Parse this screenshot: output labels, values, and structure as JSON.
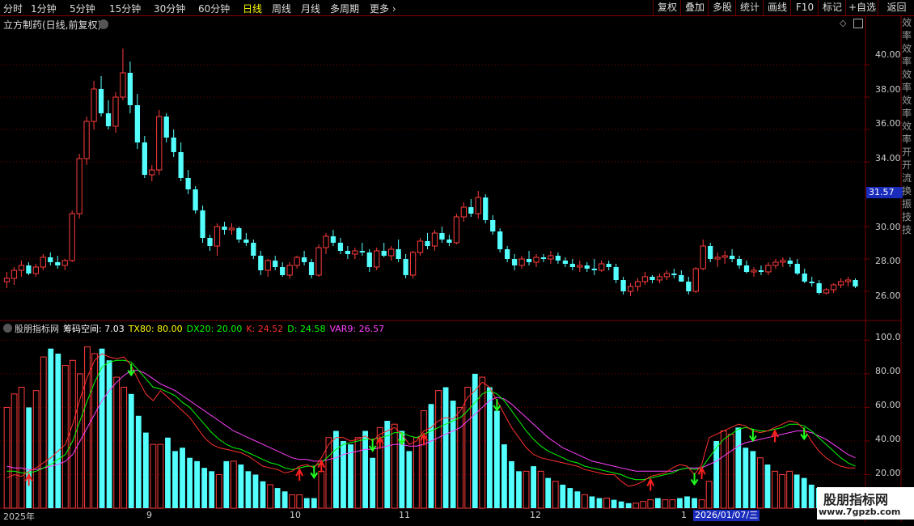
{
  "toolbar": {
    "periods": [
      "分时",
      "1分钟",
      "5分钟",
      "15分钟",
      "30分钟",
      "60分钟",
      "日线",
      "周线",
      "月线",
      "多周期",
      "更多 ›"
    ],
    "active_period": "日线",
    "right_buttons": [
      "复权",
      "叠加",
      "多股",
      "统计",
      "画线",
      "F10",
      "标记",
      "+自选",
      "返回"
    ]
  },
  "main_panel": {
    "title": "立方制药(日线,前复权)",
    "price_axis": [
      "40.00",
      "38.00",
      "36.00",
      "34.00",
      "31.57",
      "30.00",
      "28.00",
      "26.00"
    ],
    "current_price": "31.57",
    "sidebar_glyphs": [
      "效",
      "率",
      "效",
      "率",
      "效",
      "率",
      "效",
      "率",
      "效",
      "率",
      "开",
      "开",
      "流",
      "换",
      "振",
      "技",
      "技"
    ]
  },
  "indicator_panel": {
    "name": "股朋指标网",
    "items": [
      {
        "label": "筹码空间: 7.03",
        "color": "#ffffff"
      },
      {
        "label": "TX80: 80.00",
        "color": "#ffff00"
      },
      {
        "label": "DX20: 20.00",
        "color": "#00ff00"
      },
      {
        "label": "K: 24.52",
        "color": "#ff3030"
      },
      {
        "label": "D: 24.58",
        "color": "#00ff00"
      },
      {
        "label": "VAR9: 26.57",
        "color": "#ff40ff"
      }
    ],
    "axis": [
      "100.0",
      "80.00",
      "60.00",
      "40.00",
      "20.00"
    ]
  },
  "date_axis": {
    "ticks": [
      "2025年",
      "9",
      "10",
      "11",
      "12",
      "1"
    ],
    "cursor_date": "2026/01/07/三"
  },
  "watermark": {
    "line1": "股朋指标网",
    "line2": "www.7gpzb.com"
  },
  "colors": {
    "up": "#ff3c3c",
    "down": "#54ffff",
    "grid": "#7a0000",
    "k_line": "#ff3030",
    "d_line": "#00ff00",
    "var9_line": "#ff40ff"
  },
  "chart_data": [
    {
      "type": "candlestick",
      "title": "立方制药(日线,前复权)",
      "ylim": [
        25,
        42
      ],
      "ohlc": [
        [
          26.6,
          27.2,
          26.2,
          26.8
        ],
        [
          26.8,
          27.5,
          26.4,
          27.3
        ],
        [
          27.3,
          27.9,
          26.9,
          27.6
        ],
        [
          27.6,
          27.8,
          27.0,
          27.1
        ],
        [
          27.1,
          27.7,
          26.9,
          27.5
        ],
        [
          27.5,
          28.3,
          27.3,
          28.1
        ],
        [
          28.1,
          28.4,
          27.6,
          27.8
        ],
        [
          27.8,
          28.2,
          27.4,
          27.6
        ],
        [
          27.6,
          28.0,
          27.3,
          27.9
        ],
        [
          27.9,
          31.0,
          27.8,
          30.8
        ],
        [
          30.8,
          34.5,
          30.5,
          34.2
        ],
        [
          34.2,
          36.8,
          33.8,
          36.5
        ],
        [
          36.5,
          39.0,
          36.0,
          38.5
        ],
        [
          38.5,
          39.3,
          36.8,
          37.0
        ],
        [
          37.0,
          37.8,
          36.0,
          36.2
        ],
        [
          36.2,
          38.3,
          35.8,
          38.0
        ],
        [
          38.0,
          41.0,
          37.8,
          39.5
        ],
        [
          39.5,
          40.2,
          37.0,
          37.5
        ],
        [
          37.5,
          38.2,
          34.8,
          35.2
        ],
        [
          35.2,
          35.6,
          33.0,
          33.2
        ],
        [
          33.2,
          33.8,
          32.8,
          33.5
        ],
        [
          33.5,
          37.2,
          33.2,
          36.8
        ],
        [
          36.8,
          37.0,
          35.2,
          35.5
        ],
        [
          35.5,
          36.0,
          34.3,
          34.6
        ],
        [
          34.6,
          35.2,
          32.8,
          33.0
        ],
        [
          33.0,
          33.5,
          32.0,
          32.3
        ],
        [
          32.3,
          32.5,
          30.8,
          31.0
        ],
        [
          31.0,
          31.3,
          29.0,
          29.3
        ],
        [
          29.3,
          29.5,
          28.5,
          28.8
        ],
        [
          28.8,
          30.2,
          28.2,
          30.0
        ],
        [
          30.0,
          30.3,
          29.5,
          29.8
        ],
        [
          29.8,
          30.2,
          29.5,
          29.9
        ],
        [
          29.9,
          30.0,
          29.0,
          29.2
        ],
        [
          29.2,
          29.6,
          28.8,
          29.0
        ],
        [
          29.0,
          29.2,
          28.0,
          28.2
        ],
        [
          28.2,
          28.5,
          27.0,
          27.3
        ],
        [
          27.3,
          28.0,
          26.9,
          27.9
        ],
        [
          27.9,
          28.2,
          27.3,
          27.5
        ],
        [
          27.5,
          27.8,
          26.9,
          27.0
        ],
        [
          27.0,
          27.8,
          26.8,
          27.6
        ],
        [
          27.6,
          28.2,
          27.4,
          28.1
        ],
        [
          28.1,
          28.5,
          27.6,
          27.8
        ],
        [
          27.8,
          28.0,
          26.8,
          27.0
        ],
        [
          27.0,
          28.9,
          26.9,
          28.7
        ],
        [
          28.7,
          29.6,
          28.3,
          29.4
        ],
        [
          29.4,
          29.8,
          28.8,
          29.0
        ],
        [
          29.0,
          29.3,
          28.3,
          28.5
        ],
        [
          28.5,
          28.8,
          28.0,
          28.3
        ],
        [
          28.3,
          28.7,
          28.0,
          28.5
        ],
        [
          28.5,
          29.0,
          28.2,
          28.4
        ],
        [
          28.4,
          28.6,
          27.2,
          27.5
        ],
        [
          27.5,
          28.7,
          27.3,
          28.5
        ],
        [
          28.5,
          29.0,
          28.1,
          28.2
        ],
        [
          28.2,
          28.8,
          27.9,
          28.6
        ],
        [
          28.6,
          29.2,
          27.8,
          28.0
        ],
        [
          28.0,
          28.3,
          26.8,
          27.0
        ],
        [
          27.0,
          28.5,
          26.8,
          28.4
        ],
        [
          28.4,
          29.3,
          28.2,
          29.1
        ],
        [
          29.1,
          29.6,
          28.6,
          28.8
        ],
        [
          28.8,
          29.8,
          28.5,
          29.6
        ],
        [
          29.6,
          30.0,
          29.0,
          29.2
        ],
        [
          29.2,
          29.5,
          28.8,
          29.0
        ],
        [
          29.0,
          30.8,
          28.9,
          30.6
        ],
        [
          30.6,
          31.5,
          30.3,
          31.2
        ],
        [
          31.2,
          31.7,
          30.6,
          30.8
        ],
        [
          30.8,
          32.2,
          30.5,
          31.8
        ],
        [
          31.8,
          32.0,
          30.2,
          30.4
        ],
        [
          30.4,
          30.7,
          29.5,
          29.7
        ],
        [
          29.7,
          29.9,
          28.4,
          28.6
        ],
        [
          28.6,
          28.8,
          27.8,
          28.0
        ],
        [
          28.0,
          28.3,
          27.3,
          27.6
        ],
        [
          27.6,
          28.2,
          27.4,
          28.0
        ],
        [
          28.0,
          28.5,
          27.6,
          27.8
        ],
        [
          27.8,
          28.3,
          27.5,
          28.1
        ],
        [
          28.1,
          28.3,
          27.8,
          28.0
        ],
        [
          28.0,
          28.5,
          27.7,
          28.2
        ],
        [
          28.2,
          28.4,
          27.7,
          27.9
        ],
        [
          27.9,
          28.1,
          27.5,
          27.7
        ],
        [
          27.7,
          28.0,
          27.3,
          27.5
        ],
        [
          27.5,
          27.9,
          27.2,
          27.6
        ],
        [
          27.6,
          27.8,
          27.2,
          27.4
        ],
        [
          27.4,
          28.0,
          27.0,
          27.3
        ],
        [
          27.3,
          27.9,
          27.2,
          27.7
        ],
        [
          27.7,
          27.9,
          27.3,
          27.5
        ],
        [
          27.5,
          27.7,
          26.5,
          26.7
        ],
        [
          26.7,
          26.9,
          25.8,
          26.0
        ],
        [
          26.0,
          26.5,
          25.7,
          26.3
        ],
        [
          26.3,
          26.8,
          26.0,
          26.6
        ],
        [
          26.6,
          27.2,
          26.4,
          26.9
        ],
        [
          26.9,
          27.0,
          26.5,
          26.7
        ],
        [
          26.7,
          27.1,
          26.5,
          26.9
        ],
        [
          26.9,
          27.3,
          26.7,
          27.1
        ],
        [
          27.1,
          27.4,
          26.8,
          27.0
        ],
        [
          27.0,
          27.3,
          26.6,
          26.6
        ],
        [
          26.6,
          26.9,
          25.8,
          26.0
        ],
        [
          26.0,
          27.5,
          25.9,
          27.4
        ],
        [
          27.4,
          29.2,
          27.3,
          28.8
        ],
        [
          28.8,
          29.0,
          27.8,
          28.0
        ],
        [
          28.0,
          28.4,
          27.5,
          28.1
        ],
        [
          28.1,
          28.5,
          27.7,
          28.2
        ],
        [
          28.2,
          28.6,
          27.8,
          28.0
        ],
        [
          28.0,
          28.2,
          27.4,
          27.6
        ],
        [
          27.6,
          27.9,
          27.1,
          27.2
        ],
        [
          27.2,
          27.5,
          26.9,
          27.3
        ],
        [
          27.3,
          27.6,
          27.0,
          27.2
        ],
        [
          27.2,
          27.8,
          27.0,
          27.6
        ],
        [
          27.6,
          28.0,
          27.4,
          27.8
        ],
        [
          27.8,
          28.1,
          27.5,
          27.9
        ],
        [
          27.9,
          28.1,
          27.5,
          27.7
        ],
        [
          27.7,
          28.0,
          27.0,
          27.1
        ],
        [
          27.1,
          27.4,
          26.5,
          26.6
        ],
        [
          26.6,
          26.9,
          26.3,
          26.5
        ],
        [
          26.5,
          26.7,
          25.8,
          25.9
        ],
        [
          25.9,
          26.2,
          25.8,
          26.1
        ],
        [
          26.1,
          26.5,
          25.9,
          26.4
        ],
        [
          26.4,
          26.8,
          26.2,
          26.6
        ],
        [
          26.6,
          26.9,
          26.3,
          26.7
        ],
        [
          26.7,
          26.8,
          26.2,
          26.3
        ]
      ]
    },
    {
      "type": "bar+line",
      "title": "股朋指标网",
      "ylim": [
        0,
        105
      ],
      "reference_lines": [
        {
          "name": "TX80",
          "value": 80
        },
        {
          "name": "DX20",
          "value": 20
        }
      ],
      "series": [
        {
          "name": "K",
          "values": [
            18,
            20,
            19,
            22,
            24,
            27,
            30,
            34,
            38,
            50,
            65,
            78,
            88,
            92,
            90,
            89,
            90,
            85,
            76,
            68,
            64,
            70,
            66,
            62,
            58,
            54,
            48,
            42,
            38,
            36,
            35,
            34,
            33,
            31,
            28,
            25,
            24,
            23,
            21,
            22,
            25,
            26,
            24,
            30,
            38,
            42,
            42,
            40,
            41,
            43,
            40,
            44,
            46,
            48,
            44,
            38,
            40,
            46,
            48,
            52,
            54,
            53,
            58,
            66,
            70,
            75,
            72,
            64,
            56,
            48,
            42,
            36,
            32,
            30,
            29,
            28,
            27,
            26,
            25,
            23,
            22,
            21,
            20,
            20,
            16,
            13,
            14,
            16,
            19,
            20,
            21,
            24,
            26,
            25,
            20,
            26,
            42,
            44,
            46,
            48,
            50,
            49,
            46,
            45,
            46,
            48,
            50,
            52,
            51,
            47,
            40,
            34,
            30,
            27,
            25,
            24,
            24
          ]
        },
        {
          "name": "D",
          "values": [
            22,
            22,
            21,
            21,
            22,
            24,
            26,
            29,
            32,
            40,
            52,
            64,
            75,
            84,
            87,
            88,
            88,
            87,
            82,
            77,
            72,
            71,
            69,
            67,
            63,
            60,
            55,
            50,
            45,
            41,
            38,
            36,
            35,
            33,
            31,
            29,
            27,
            26,
            24,
            23,
            24,
            25,
            25,
            27,
            31,
            35,
            38,
            39,
            40,
            41,
            41,
            42,
            43,
            45,
            45,
            43,
            42,
            44,
            46,
            48,
            50,
            52,
            54,
            58,
            63,
            68,
            70,
            68,
            64,
            58,
            52,
            46,
            41,
            37,
            34,
            32,
            30,
            28,
            27,
            25,
            24,
            23,
            22,
            21,
            20,
            18,
            17,
            17,
            18,
            19,
            20,
            21,
            23,
            24,
            23,
            24,
            30,
            36,
            41,
            44,
            47,
            48,
            47,
            46,
            46,
            47,
            48,
            50,
            50,
            49,
            46,
            42,
            38,
            34,
            30,
            27,
            25
          ]
        },
        {
          "name": "VAR9",
          "values": [
            25,
            24,
            24,
            23,
            23,
            24,
            25,
            26,
            28,
            32,
            40,
            48,
            56,
            64,
            70,
            75,
            79,
            82,
            82,
            80,
            77,
            74,
            72,
            70,
            67,
            64,
            61,
            58,
            55,
            52,
            49,
            46,
            44,
            42,
            40,
            38,
            36,
            34,
            32,
            30,
            29,
            29,
            28,
            28,
            29,
            30,
            32,
            33,
            34,
            35,
            35,
            36,
            37,
            38,
            38,
            37,
            37,
            38,
            40,
            42,
            44,
            46,
            48,
            52,
            56,
            60,
            64,
            66,
            65,
            62,
            58,
            54,
            50,
            46,
            42,
            39,
            36,
            34,
            32,
            30,
            28,
            27,
            26,
            25,
            24,
            23,
            22,
            22,
            22,
            22,
            22,
            22,
            23,
            24,
            24,
            24,
            26,
            28,
            31,
            34,
            37,
            39,
            40,
            41,
            42,
            43,
            44,
            45,
            46,
            46,
            45,
            43,
            41,
            38,
            35,
            32,
            30
          ]
        },
        {
          "name": "筹码空间",
          "values": [
            60,
            68,
            72,
            60,
            70,
            90,
            95,
            92,
            85,
            88,
            80,
            96,
            92,
            95,
            88,
            78,
            72,
            68,
            55,
            45,
            38,
            38,
            42,
            34,
            36,
            30,
            28,
            24,
            22,
            20,
            28,
            28,
            26,
            22,
            20,
            16,
            14,
            12,
            10,
            8,
            8,
            6,
            6,
            22,
            42,
            46,
            40,
            38,
            42,
            46,
            30,
            48,
            52,
            50,
            46,
            34,
            42,
            58,
            62,
            70,
            72,
            64,
            60,
            72,
            80,
            78,
            72,
            58,
            38,
            28,
            22,
            22,
            25,
            22,
            18,
            16,
            14,
            12,
            10,
            8,
            7,
            6,
            6,
            5,
            4,
            3,
            3,
            4,
            5,
            6,
            5,
            5,
            6,
            7,
            6,
            5,
            16,
            40,
            46,
            44,
            48,
            36,
            34,
            30,
            26,
            22,
            20,
            22,
            20,
            18,
            14,
            12,
            10,
            8,
            8,
            7,
            7
          ]
        }
      ]
    }
  ]
}
